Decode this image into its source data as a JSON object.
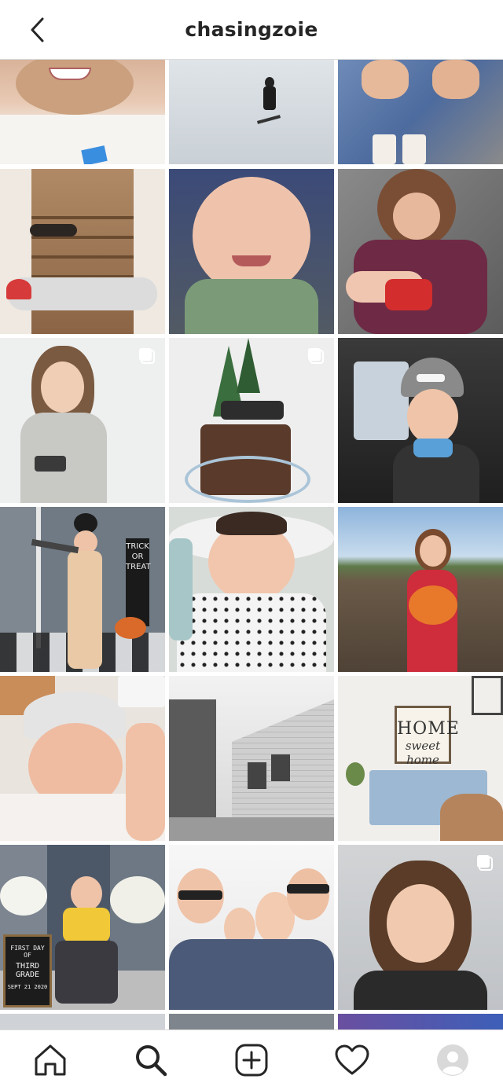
{
  "header": {
    "username": "chasingzoie",
    "back_icon": "chevron-left-icon"
  },
  "posts": [
    {
      "subject": "girl smiling close-up",
      "multi": false
    },
    {
      "subject": "snowboarder on snowy slope",
      "multi": false
    },
    {
      "subject": "two girls with milkshakes",
      "multi": false
    },
    {
      "subject": "child lying on stairs with cat",
      "multi": false
    },
    {
      "subject": "smiling baby in green shirt",
      "multi": false
    },
    {
      "subject": "girl holding baby",
      "multi": false
    },
    {
      "subject": "girl in bear hoodie",
      "multi": true
    },
    {
      "subject": "chocolate cake with jeep topper",
      "multi": true
    },
    {
      "subject": "smiling girl in car",
      "multi": false
    },
    {
      "subject": "ghostbuster costume on porch",
      "multi": false
    },
    {
      "subject": "sleeping newborn",
      "multi": false
    },
    {
      "subject": "girl holding pumpkin in field",
      "multi": false
    },
    {
      "subject": "newborn in hospital",
      "multi": false
    },
    {
      "subject": "black and white house",
      "multi": false
    },
    {
      "subject": "home sweet home console",
      "multi": false
    },
    {
      "subject": "first day of third grade",
      "multi": false
    },
    {
      "subject": "family selfie",
      "multi": false
    },
    {
      "subject": "girl with side-shave haircut",
      "multi": true
    }
  ],
  "signs": {
    "letter_board": [
      "FIRST DAY OF",
      "THIRD",
      "GRADE",
      "SEPT 21 2020"
    ],
    "home_sign": [
      "HOME",
      "sweet home"
    ],
    "trick_sign": [
      "TRICK",
      "OR",
      "TREAT"
    ]
  },
  "bottom_nav": [
    {
      "name": "home",
      "icon": "home-icon"
    },
    {
      "name": "search",
      "icon": "search-icon",
      "active": true
    },
    {
      "name": "create",
      "icon": "plus-square-icon"
    },
    {
      "name": "activity",
      "icon": "heart-icon"
    },
    {
      "name": "profile",
      "icon": "avatar-icon"
    }
  ],
  "colors": {
    "divider": "#dbdbdb",
    "icon": "#262626",
    "background": "#ffffff"
  }
}
